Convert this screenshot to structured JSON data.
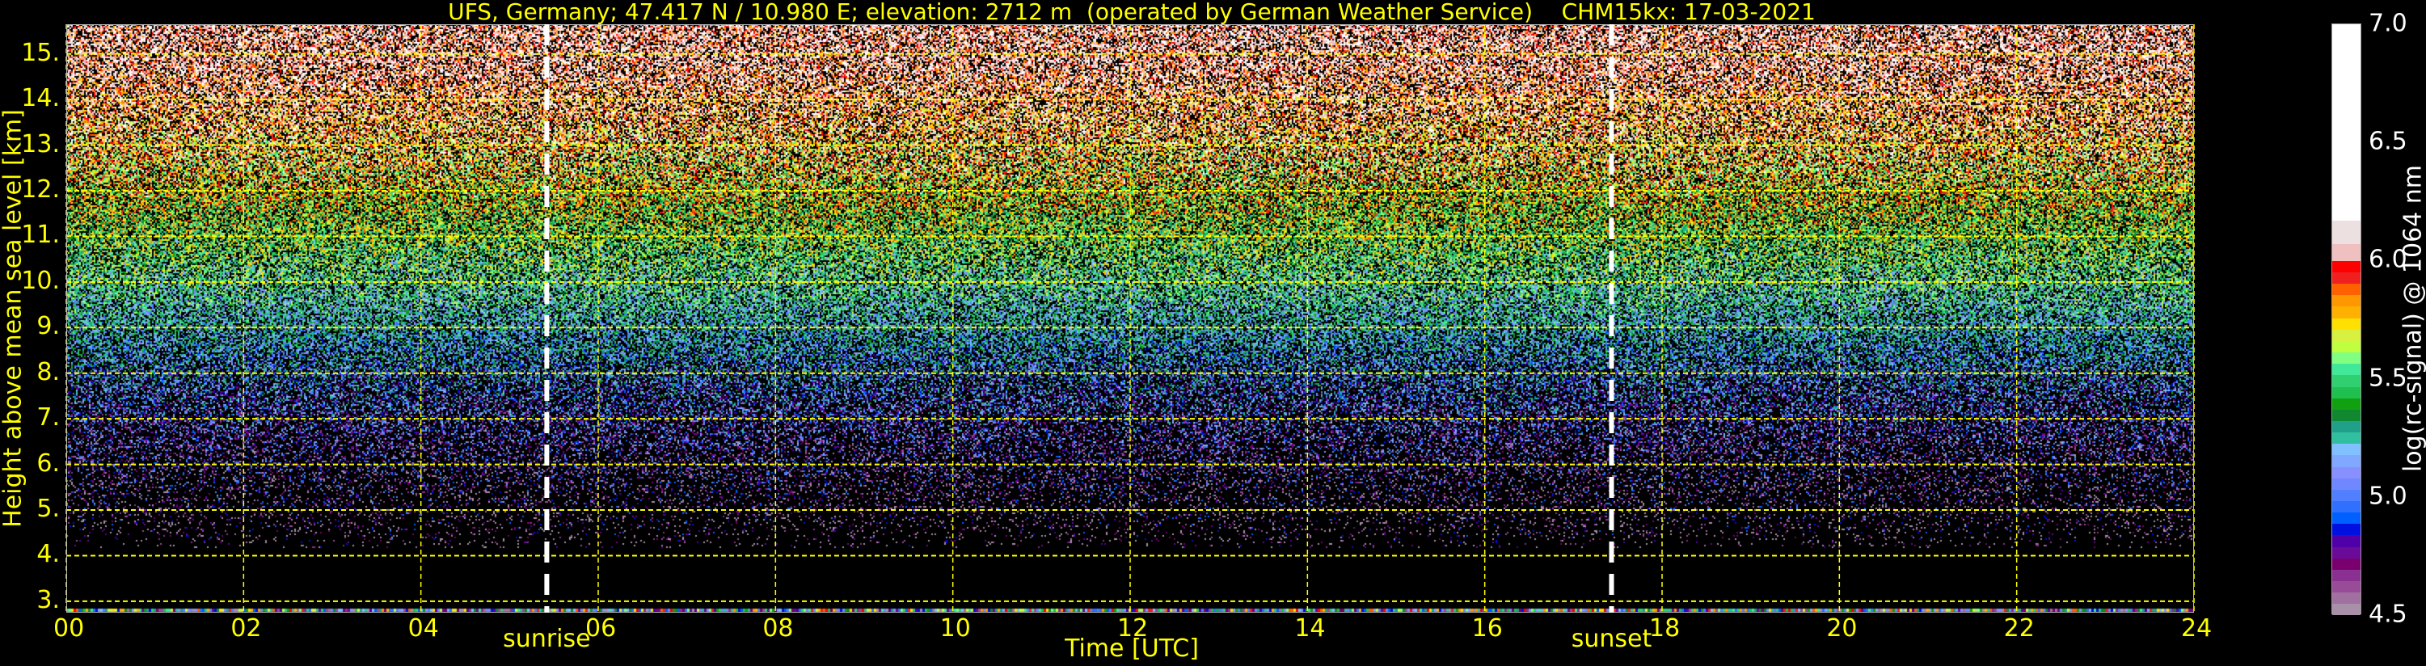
{
  "chart_data": {
    "type": "heatmap",
    "title": "UFS, Germany; 47.417 N / 10.980 E; elevation: 2712 m  (operated by German Weather Service)    CHM15kx: 17-03-2021",
    "xlabel": "Time [UTC]",
    "ylabel": "Height above mean sea level [km]",
    "xlim": [
      0,
      24
    ],
    "ylim": [
      2.75,
      15.65
    ],
    "x_ticks": [
      "00",
      "02",
      "04",
      "06",
      "08",
      "10",
      "12",
      "14",
      "16",
      "18",
      "20",
      "22",
      "24"
    ],
    "y_ticks": [
      "3.",
      "4.",
      "5.",
      "6.",
      "7.",
      "8.",
      "9.",
      "10.",
      "11.",
      "12.",
      "13.",
      "14.",
      "15."
    ],
    "grid": true,
    "annotations": [
      {
        "label": "sunrise",
        "x": 5.42
      },
      {
        "label": "sunset",
        "x": 17.43
      }
    ],
    "signal_onset_km": 4.2,
    "colorbar": {
      "label": "log(rc-signal) @ 1064 nm",
      "range": [
        4.5,
        7.0
      ],
      "ticks": [
        "4.5",
        "5.0",
        "5.5",
        "6.0",
        "6.5",
        "7.0"
      ],
      "colors": [
        "#a890a8",
        "#a070a0",
        "#984c98",
        "#8a3090",
        "#7a0070",
        "#6a0a98",
        "#5000a8",
        "#0010e0",
        "#0060ff",
        "#3070ff",
        "#5080ff",
        "#7088ff",
        "#8890ff",
        "#80a8ff",
        "#80c0ff",
        "#30c0a0",
        "#20a088",
        "#108830",
        "#10a010",
        "#20c050",
        "#30d070",
        "#40e898",
        "#80ff80",
        "#c0ff40",
        "#d8f040",
        "#ffe000",
        "#ffb000",
        "#ff9800",
        "#ff6000",
        "#f02020",
        "#ff0000"
      ],
      "upper_colors": [
        {
          "from": 6.0,
          "to": 6.07,
          "color": "#f0c0c0"
        },
        {
          "from": 6.07,
          "to": 6.17,
          "color": "#ece0e0"
        },
        {
          "from": 6.17,
          "to": 7.0,
          "color": "#ffffff"
        }
      ]
    }
  }
}
